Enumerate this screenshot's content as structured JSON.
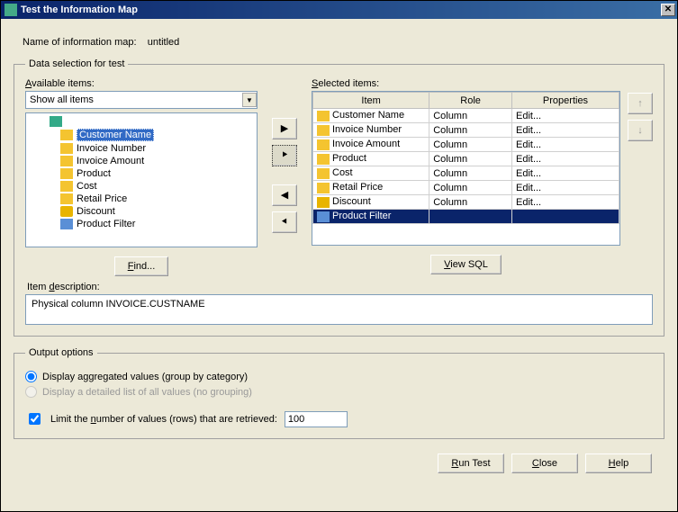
{
  "window": {
    "title": "Test the Information Map",
    "close_glyph": "✕"
  },
  "map_name_label": "Name of information map:",
  "map_name_value": "untitled",
  "group_data_selection": "Data selection for test",
  "available": {
    "label": "Available items:",
    "combo_value": "Show all items",
    "tree": [
      {
        "kind": "cube",
        "label": ""
      },
      {
        "kind": "col",
        "label": "Customer Name",
        "selected": true
      },
      {
        "kind": "col",
        "label": "Invoice Number"
      },
      {
        "kind": "col",
        "label": "Invoice Amount"
      },
      {
        "kind": "col",
        "label": "Product"
      },
      {
        "kind": "col",
        "label": "Cost"
      },
      {
        "kind": "col",
        "label": "Retail Price"
      },
      {
        "kind": "disc",
        "label": "Discount"
      },
      {
        "kind": "filter",
        "label": "Product Filter"
      }
    ],
    "find_button": "Find..."
  },
  "transfer": {
    "add": "▶",
    "add_all": "⯈",
    "remove": "◀",
    "remove_all": "⯇"
  },
  "selected": {
    "label": "Selected items:",
    "headers": {
      "item": "Item",
      "role": "Role",
      "props": "Properties"
    },
    "rows": [
      {
        "icon": "col",
        "item": "Customer Name",
        "role": "Column",
        "props": "Edit..."
      },
      {
        "icon": "col",
        "item": "Invoice Number",
        "role": "Column",
        "props": "Edit..."
      },
      {
        "icon": "col",
        "item": "Invoice Amount",
        "role": "Column",
        "props": "Edit..."
      },
      {
        "icon": "col",
        "item": "Product",
        "role": "Column",
        "props": "Edit..."
      },
      {
        "icon": "col",
        "item": "Cost",
        "role": "Column",
        "props": "Edit..."
      },
      {
        "icon": "col",
        "item": "Retail Price",
        "role": "Column",
        "props": "Edit..."
      },
      {
        "icon": "disc",
        "item": "Discount",
        "role": "Column",
        "props": "Edit..."
      },
      {
        "icon": "filter",
        "item": "Product Filter",
        "role": "",
        "props": "",
        "selected": true
      }
    ],
    "view_sql_button": "View SQL",
    "move_up": "↑",
    "move_down": "↓"
  },
  "description": {
    "label": "Item description:",
    "value": "Physical column INVOICE.CUSTNAME"
  },
  "group_output_options": "Output options",
  "output": {
    "radio_agg": "Display aggregated values (group by category)",
    "radio_detailed": "Display a detailed list of all values (no grouping)",
    "limit_prefix": "Limit the ",
    "limit_underline": "n",
    "limit_suffix": "umber of values (rows) that are retrieved:",
    "limit_value": "100"
  },
  "buttons": {
    "run_test": "Run Test",
    "close": "Close",
    "help": "Help"
  },
  "underlines": {
    "available_items_A": "A",
    "available_items_rest": "vailable items:",
    "selected_items_S": "S",
    "selected_items_rest": "elected items:",
    "find_F": "F",
    "find_rest": "ind...",
    "view_V": "V",
    "view_rest": "iew SQL",
    "item_desc_pre": "Item ",
    "item_desc_d": "d",
    "item_desc_post": "escription:",
    "run_R": "R",
    "run_rest": "un Test",
    "close_C": "C",
    "close_rest": "lose",
    "help_H": "H",
    "help_rest": "elp"
  }
}
